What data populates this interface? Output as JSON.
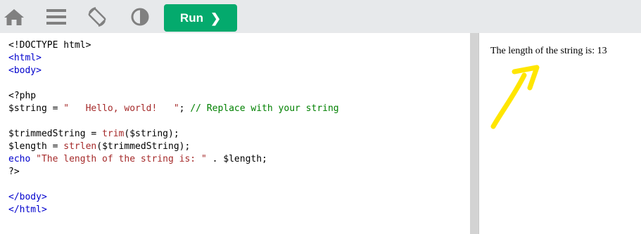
{
  "toolbar": {
    "icons": [
      "home-icon",
      "menu-icon",
      "rotate-icon",
      "contrast-icon"
    ],
    "run_label": "Run",
    "run_chevron": "❯",
    "accent_color": "#04aa6d"
  },
  "editor": {
    "lines": [
      [
        {
          "t": "<!DOCTYPE html>",
          "c": "pl"
        }
      ],
      [
        {
          "t": "<html>",
          "c": "tag"
        }
      ],
      [
        {
          "t": "<body>",
          "c": "tag"
        }
      ],
      [],
      [
        {
          "t": "<?php",
          "c": "pl"
        }
      ],
      [
        {
          "t": "$string = ",
          "c": "pl"
        },
        {
          "t": "\"   Hello, world!   \"",
          "c": "str"
        },
        {
          "t": "; ",
          "c": "pl"
        },
        {
          "t": "// Replace with your string",
          "c": "cm"
        }
      ],
      [],
      [
        {
          "t": "$trimmedString = ",
          "c": "pl"
        },
        {
          "t": "trim",
          "c": "fn"
        },
        {
          "t": "($string);",
          "c": "pl"
        }
      ],
      [
        {
          "t": "$length = ",
          "c": "pl"
        },
        {
          "t": "strlen",
          "c": "fn"
        },
        {
          "t": "($trimmedString);",
          "c": "pl"
        }
      ],
      [
        {
          "t": "echo ",
          "c": "kw"
        },
        {
          "t": "\"The length of the string is: \"",
          "c": "str"
        },
        {
          "t": " . $length;",
          "c": "pl"
        }
      ],
      [
        {
          "t": "?>",
          "c": "pl"
        }
      ],
      [],
      [
        {
          "t": "</body>",
          "c": "tag"
        }
      ],
      [
        {
          "t": "</html>",
          "c": "tag"
        }
      ]
    ]
  },
  "result": {
    "output": "The length of the string is: 13",
    "annotation_color": "#ffe600"
  }
}
